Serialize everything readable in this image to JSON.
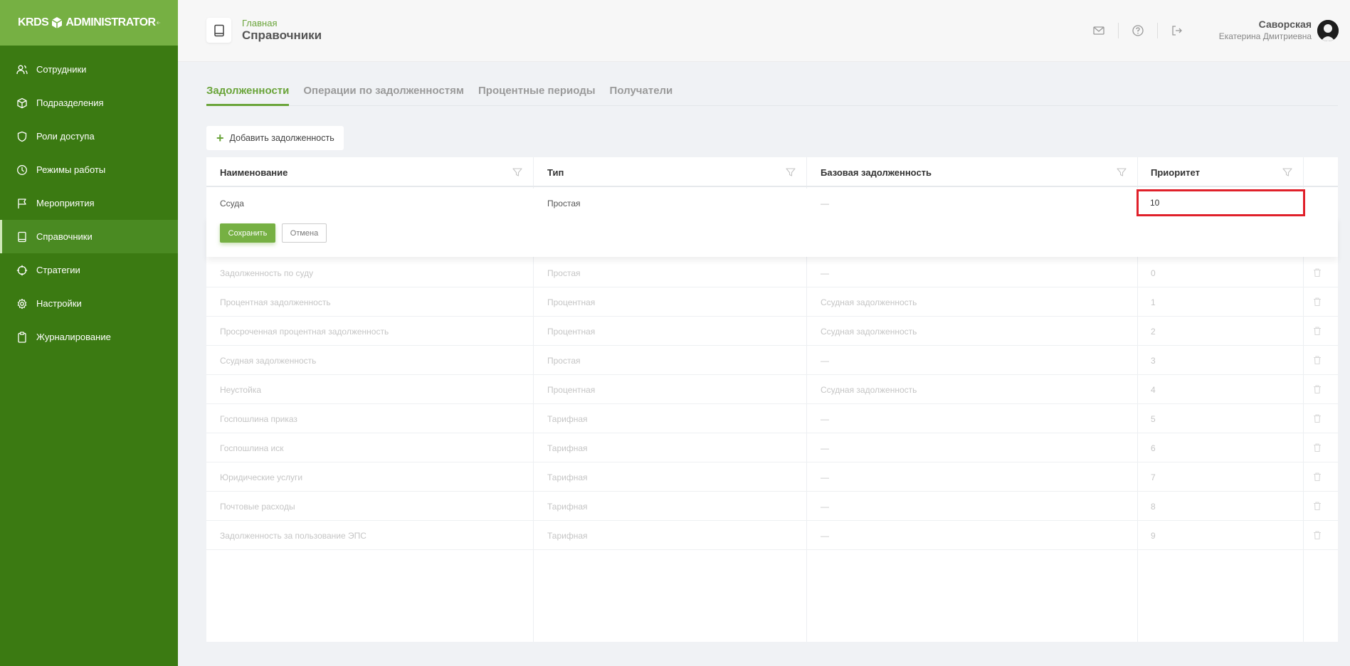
{
  "brand": {
    "left": "KRDS",
    "right": "ADMINISTRATOR"
  },
  "sidebar": {
    "items": [
      {
        "label": "Сотрудники",
        "icon": "users-icon"
      },
      {
        "label": "Подразделения",
        "icon": "cube-icon"
      },
      {
        "label": "Роли доступа",
        "icon": "shield-icon"
      },
      {
        "label": "Режимы работы",
        "icon": "clock-icon"
      },
      {
        "label": "Мероприятия",
        "icon": "flag-icon"
      },
      {
        "label": "Справочники",
        "icon": "book-icon",
        "active": true
      },
      {
        "label": "Стратегии",
        "icon": "crosshair-icon"
      },
      {
        "label": "Настройки",
        "icon": "gear-icon"
      },
      {
        "label": "Журналирование",
        "icon": "clipboard-icon"
      }
    ]
  },
  "header": {
    "breadcrumb": "Главная",
    "title": "Справочники",
    "user": {
      "last_name": "Саворская",
      "first_names": "Екатерина Дмитриевна"
    }
  },
  "tabs": [
    "Задолженности",
    "Операции по задолженностям",
    "Процентные периоды",
    "Получатели"
  ],
  "add_button": "Добавить задолженность",
  "table": {
    "columns": [
      "Наименование",
      "Тип",
      "Базовая задолженность",
      "Приоритет"
    ],
    "editing_row": {
      "name": "Ссуда",
      "type": "Простая",
      "base": "—",
      "priority": "10"
    },
    "actions": {
      "save": "Сохранить",
      "cancel": "Отмена"
    },
    "rows": [
      {
        "name": "Задолженность по суду",
        "type": "Простая",
        "base": "—",
        "priority": "0"
      },
      {
        "name": "Процентная задолженность",
        "type": "Процентная",
        "base": "Ссудная задолженность",
        "priority": "1"
      },
      {
        "name": "Просроченная процентная задолженность",
        "type": "Процентная",
        "base": "Ссудная задолженность",
        "priority": "2"
      },
      {
        "name": "Ссудная задолженность",
        "type": "Простая",
        "base": "—",
        "priority": "3"
      },
      {
        "name": "Неустойка",
        "type": "Процентная",
        "base": "Ссудная задолженность",
        "priority": "4"
      },
      {
        "name": "Госпошлина приказ",
        "type": "Тарифная",
        "base": "—",
        "priority": "5"
      },
      {
        "name": "Госпошлина иск",
        "type": "Тарифная",
        "base": "—",
        "priority": "6"
      },
      {
        "name": "Юридические услуги",
        "type": "Тарифная",
        "base": "—",
        "priority": "7"
      },
      {
        "name": "Почтовые расходы",
        "type": "Тарифная",
        "base": "—",
        "priority": "8"
      },
      {
        "name": "Задолженность за пользование ЭПС",
        "type": "Тарифная",
        "base": "—",
        "priority": "9"
      }
    ]
  },
  "colors": {
    "sidebar": "#3b7a12",
    "brand": "#76b043",
    "accent": "#6aa43a",
    "highlight": "#e0202a"
  }
}
